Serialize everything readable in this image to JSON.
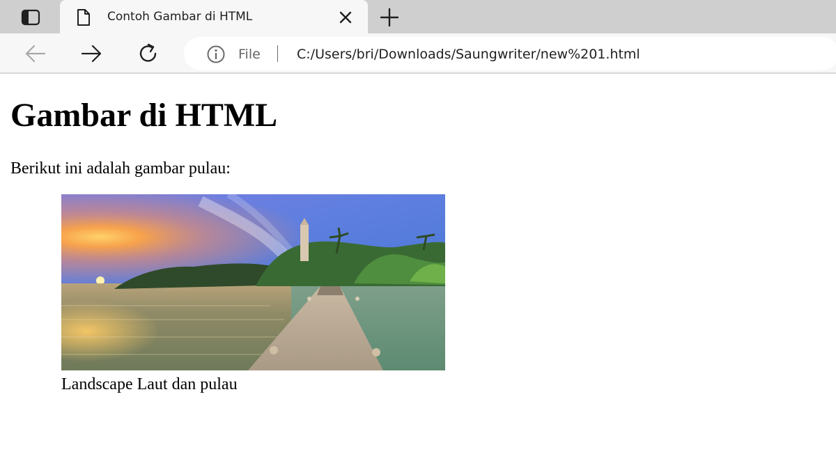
{
  "browser": {
    "tab": {
      "title": "Contoh Gambar di HTML"
    },
    "address_bar": {
      "scheme_label": "File",
      "url": "C:/Users/bri/Downloads/Saungwriter/new%201.html"
    },
    "icons": {
      "tab_actions": "tab-actions-icon",
      "page": "page-icon",
      "close": "close-icon",
      "new_tab": "plus-icon",
      "back": "arrow-left-icon",
      "forward": "arrow-right-icon",
      "refresh": "refresh-icon",
      "site_info": "info-icon"
    }
  },
  "page": {
    "heading": "Gambar di HTML",
    "paragraph": "Berikut ini adalah gambar pulau:",
    "figure": {
      "caption": "Landscape Laut dan pulau"
    }
  },
  "colors": {
    "tabstrip_bg": "#cfcfcf",
    "toolbar_bg": "#f7f7f7",
    "page_bg": "#ffffff"
  }
}
